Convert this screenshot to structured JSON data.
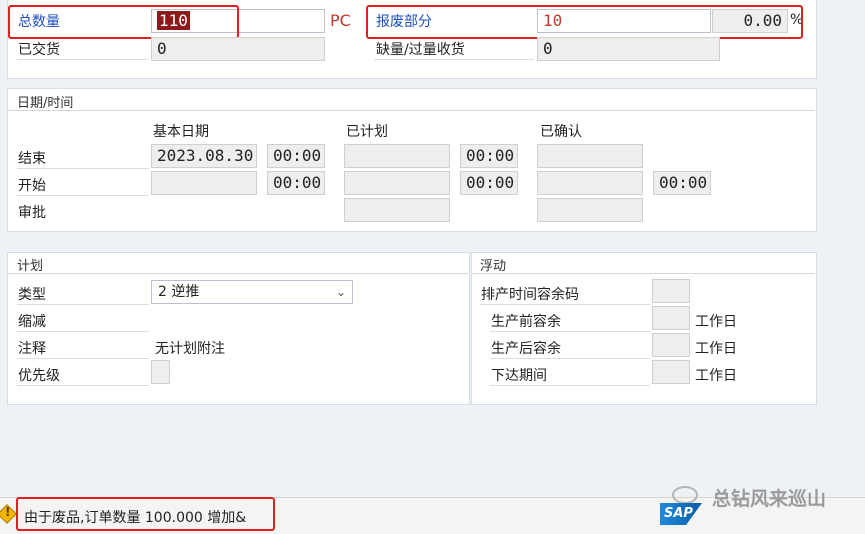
{
  "quantities": {
    "total_qty_label": "总数量",
    "total_qty_value": "110",
    "unit": "PC",
    "scrap_label": "报废部分",
    "scrap_value": "10",
    "scrap_pct": "0.00",
    "pct_sign": "%",
    "delivered_label": "已交货",
    "delivered_value": "0",
    "shortage_label": "缺量/过量收货",
    "shortage_value": "0"
  },
  "dates": {
    "title": "日期/时间",
    "col_basic": "基本日期",
    "col_scheduled": "已计划",
    "col_confirmed": "已确认",
    "row_end": "结束",
    "row_start": "开始",
    "row_release": "审批",
    "end_basic_date": "2023.08.30",
    "end_basic_time": "00:00",
    "end_sched_time": "00:00",
    "start_basic_time": "00:00",
    "start_sched_time": "00:00",
    "start_confirmed_time": "00:00"
  },
  "planning": {
    "title": "计划",
    "type_label": "类型",
    "type_value": "2 逆推",
    "reduction_label": "缩减",
    "note_label": "注释",
    "note_value": "无计划附注",
    "priority_label": "优先级"
  },
  "float": {
    "title": "浮动",
    "sched_margin_label": "排产时间容余码",
    "before_label": "生产前容余",
    "after_label": "生产后容余",
    "release_period_label": "下达期间",
    "unit": "工作日"
  },
  "status": {
    "message": "由于废品,订单数量 100.000 增加&"
  },
  "watermark": {
    "text": "总钻风来巡山"
  },
  "logo": {
    "text": "SAP"
  }
}
